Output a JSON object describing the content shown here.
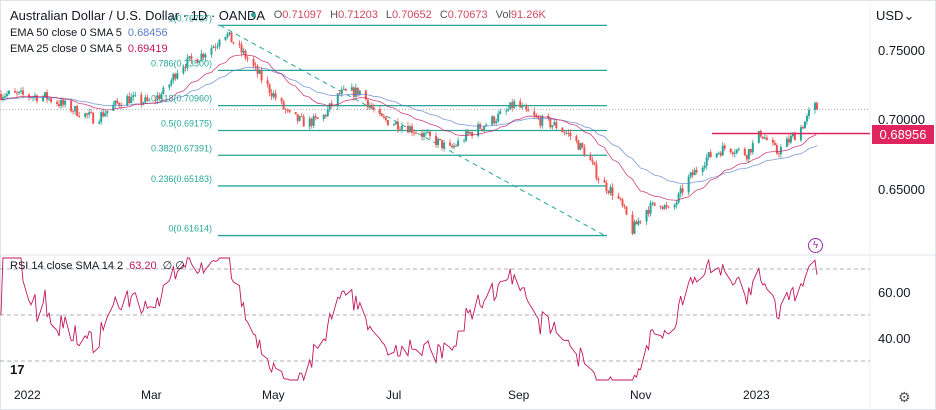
{
  "header": {
    "title": "Australian Dollar / U.S. Dollar · 1D · OANDA",
    "open_label": "O",
    "open": "0.71097",
    "high_label": "H",
    "high": "0.71203",
    "low_label": "L",
    "low": "0.70652",
    "close_label": "C",
    "close": "0.70673",
    "vol_label": "Vol",
    "vol": "91.26K"
  },
  "indicators": [
    {
      "label": "EMA 50 close 0 SMA 5",
      "value": "0.68456",
      "color": "#5b7fc9"
    },
    {
      "label": "EMA 25 close 0 SMA 5",
      "value": "0.69419",
      "color": "#c2185b"
    }
  ],
  "rsi_legend": {
    "label": "RSI 14 close SMA 14 2",
    "value": "63.20",
    "extra": "∅ ∅"
  },
  "price_axis": {
    "currency": "USD",
    "ticks": [
      "0.75000",
      "0.70000",
      "0.65000"
    ],
    "last_price_label": "0.68956"
  },
  "rsi_axis": {
    "ticks": [
      "60.00",
      "40.00"
    ]
  },
  "time_axis": [
    "2022",
    "Mar",
    "May",
    "Jul",
    "Sep",
    "Nov",
    "2023"
  ],
  "fib_labels": [
    "1(0.76737)",
    "0.786(0.73500)",
    "0.618(0.70960)",
    "0.5(0.69175)",
    "0.382(0.67391)",
    "0.236(0.65183)",
    "0(0.61614)"
  ],
  "colors": {
    "up": "#26a69a",
    "down": "#ef5350",
    "fib": "#26a69a",
    "rsi": "#c2185b",
    "hline": "#e0245e"
  },
  "chart_data": {
    "type": "candlestick",
    "title": "Australian Dollar / U.S. Dollar · 1D · OANDA",
    "ylim": [
      0.605,
      0.785
    ],
    "fib_levels": [
      0.76737,
      0.735,
      0.7096,
      0.69175,
      0.67391,
      0.65183,
      0.61614
    ],
    "horizontal_line": 0.68956,
    "current_price": 0.70673,
    "rsi_levels": [
      70,
      50,
      30
    ],
    "close_path_day_price": [
      [
        -12,
        0.718
      ],
      [
        10,
        0.716
      ],
      [
        30,
        0.703
      ],
      [
        35,
        0.7
      ],
      [
        50,
        0.715
      ],
      [
        62,
        0.712
      ],
      [
        70,
        0.72
      ],
      [
        77,
        0.738
      ],
      [
        87,
        0.745
      ],
      [
        96,
        0.755
      ],
      [
        98,
        0.765
      ],
      [
        110,
        0.745
      ],
      [
        120,
        0.725
      ],
      [
        132,
        0.702
      ],
      [
        140,
        0.697
      ],
      [
        148,
        0.7
      ],
      [
        157,
        0.718
      ],
      [
        167,
        0.72
      ],
      [
        177,
        0.7
      ],
      [
        190,
        0.695
      ],
      [
        205,
        0.684
      ],
      [
        212,
        0.678
      ],
      [
        222,
        0.69
      ],
      [
        240,
        0.705
      ],
      [
        244,
        0.711
      ],
      [
        255,
        0.7
      ],
      [
        265,
        0.695
      ],
      [
        272,
        0.688
      ],
      [
        280,
        0.675
      ],
      [
        287,
        0.655
      ],
      [
        295,
        0.645
      ],
      [
        300,
        0.63
      ],
      [
        303,
        0.62
      ],
      [
        310,
        0.635
      ],
      [
        317,
        0.64
      ],
      [
        322,
        0.632
      ],
      [
        330,
        0.655
      ],
      [
        340,
        0.672
      ],
      [
        350,
        0.68
      ],
      [
        360,
        0.675
      ],
      [
        367,
        0.69
      ],
      [
        375,
        0.676
      ],
      [
        385,
        0.69
      ],
      [
        390,
        0.7
      ],
      [
        393,
        0.711
      ],
      [
        395,
        0.7067
      ]
    ]
  }
}
